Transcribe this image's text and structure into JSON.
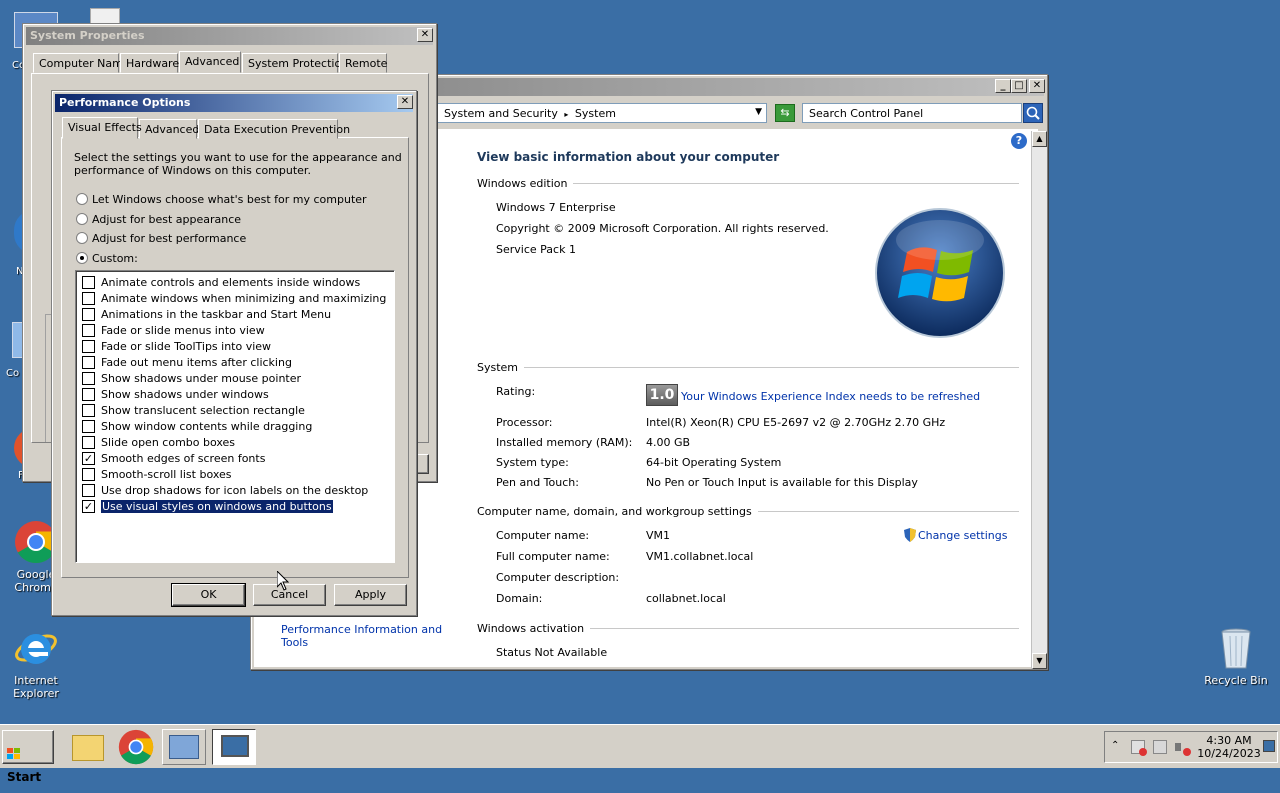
{
  "desktop": {
    "icons": [
      {
        "label": "Google Chrome"
      },
      {
        "label": "Internet Explorer"
      },
      {
        "label": "Recycle Bin"
      }
    ],
    "partial_labels": [
      "Co",
      "N",
      "Co",
      "F"
    ]
  },
  "control_panel": {
    "breadcrumb": [
      "System and Security",
      "System"
    ],
    "search_placeholder": "Search Control Panel",
    "heading": "View basic information about your computer",
    "sections": {
      "edition": "Windows edition",
      "system": "System",
      "computer": "Computer name, domain, and workgroup settings",
      "activation": "Windows activation"
    },
    "edition_name": "Windows 7 Enterprise",
    "copyright": "Copyright © 2009 Microsoft Corporation.  All rights reserved.",
    "service_pack": "Service Pack 1",
    "rating_label": "Rating:",
    "rating_value": "1.0",
    "rating_link": "Your Windows Experience Index needs to be refreshed",
    "processor_label": "Processor:",
    "processor_value": "Intel(R) Xeon(R) CPU E5-2697 v2 @ 2.70GHz   2.70 GHz",
    "ram_label": "Installed memory (RAM):",
    "ram_value": "4.00 GB",
    "systype_label": "System type:",
    "systype_value": "64-bit Operating System",
    "pen_label": "Pen and Touch:",
    "pen_value": "No Pen or Touch Input is available for this Display",
    "compname_label": "Computer name:",
    "compname_value": "VM1",
    "fullname_label": "Full computer name:",
    "fullname_value": "VM1.collabnet.local",
    "desc_label": "Computer description:",
    "desc_value": "",
    "domain_label": "Domain:",
    "domain_value": "collabnet.local",
    "change_settings": "Change settings",
    "activation_status": "Status Not Available",
    "see_also_link_1": "Performance Information and",
    "see_also_link_2": "Tools"
  },
  "system_properties": {
    "title": "System Properties",
    "tabs": [
      "Computer Name",
      "Hardware",
      "Advanced",
      "System Protection",
      "Remote"
    ],
    "selected_tab": "Advanced"
  },
  "performance_options": {
    "title": "Performance Options",
    "tabs": [
      "Visual Effects",
      "Advanced",
      "Data Execution Prevention"
    ],
    "selected_tab": "Visual Effects",
    "description": [
      "Select the settings you want to use for the appearance and",
      "performance of Windows on this computer."
    ],
    "radios": [
      {
        "label": "Let Windows choose what's best for my computer",
        "selected": false
      },
      {
        "label": "Adjust for best appearance",
        "selected": false
      },
      {
        "label": "Adjust for best performance",
        "selected": false
      },
      {
        "label": "Custom:",
        "selected": true
      }
    ],
    "effects": [
      {
        "label": "Animate controls and elements inside windows",
        "checked": false
      },
      {
        "label": "Animate windows when minimizing and maximizing",
        "checked": false
      },
      {
        "label": "Animations in the taskbar and Start Menu",
        "checked": false
      },
      {
        "label": "Fade or slide menus into view",
        "checked": false
      },
      {
        "label": "Fade or slide ToolTips into view",
        "checked": false
      },
      {
        "label": "Fade out menu items after clicking",
        "checked": false
      },
      {
        "label": "Show shadows under mouse pointer",
        "checked": false
      },
      {
        "label": "Show shadows under windows",
        "checked": false
      },
      {
        "label": "Show translucent selection rectangle",
        "checked": false
      },
      {
        "label": "Show window contents while dragging",
        "checked": false
      },
      {
        "label": "Slide open combo boxes",
        "checked": false
      },
      {
        "label": "Smooth edges of screen fonts",
        "checked": true
      },
      {
        "label": "Smooth-scroll list boxes",
        "checked": false
      },
      {
        "label": "Use drop shadows for icon labels on the desktop",
        "checked": false
      },
      {
        "label": "Use visual styles on windows and buttons",
        "checked": true
      }
    ],
    "buttons": {
      "ok": "OK",
      "cancel": "Cancel",
      "apply": "Apply"
    }
  },
  "taskbar": {
    "start_label": "Start",
    "time": "4:30 AM",
    "date": "10/24/2023"
  },
  "icons": [
    "close-icon",
    "minimize-icon",
    "maximize-icon",
    "search-icon",
    "help-icon",
    "refresh-icon",
    "shield-icon",
    "windows-logo-icon",
    "chrome-icon",
    "ie-icon",
    "recycle-bin-icon",
    "folder-icon",
    "monitor-icon"
  ]
}
